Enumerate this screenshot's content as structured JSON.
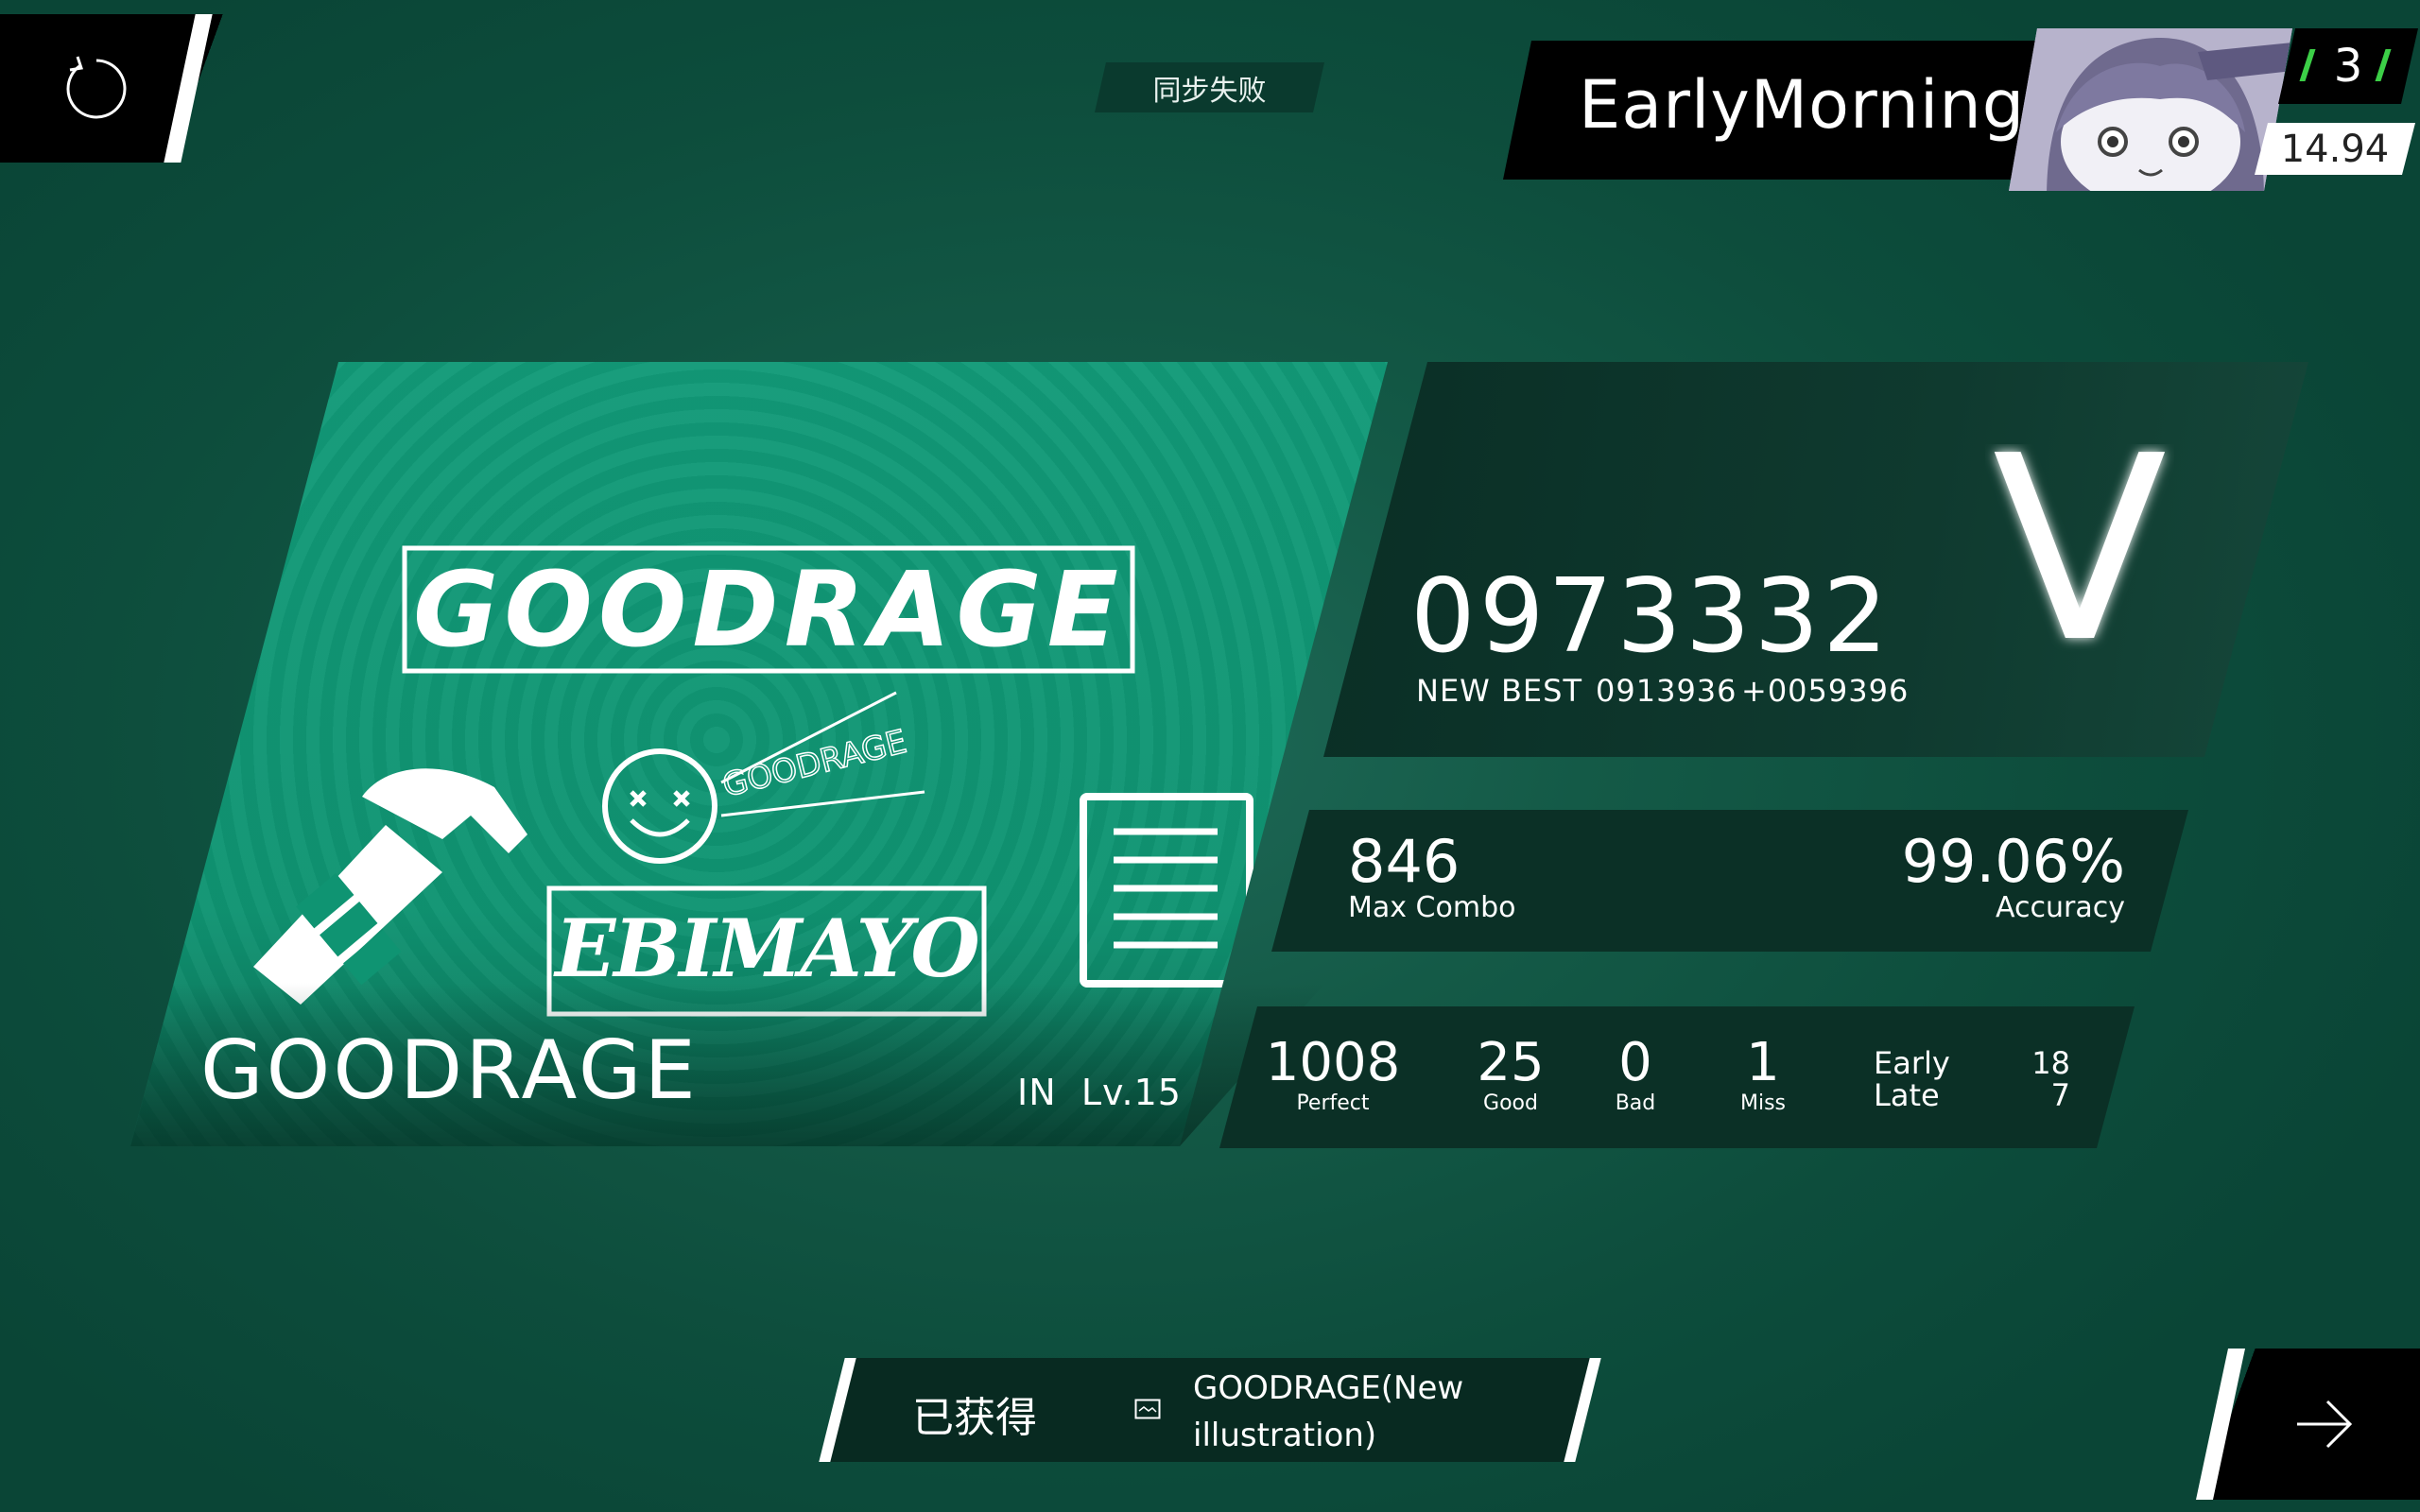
{
  "sync_status": "同步失败",
  "player": {
    "name": "EarlyMorning",
    "rank": "3",
    "rating": "14.94"
  },
  "song": {
    "title": "GOODRAGE",
    "difficulty": "IN",
    "level": "Lv.15",
    "artwork_texts": [
      "GOODRAGE",
      "GOODRAGE",
      "EBIMAYO"
    ]
  },
  "result": {
    "score": "0973332",
    "new_best_label": "NEW BEST",
    "previous_best": "0913936",
    "delta": "+0059396",
    "grade": "V",
    "max_combo": "846",
    "max_combo_label": "Max Combo",
    "accuracy": "99.06%",
    "accuracy_label": "Accuracy"
  },
  "judgements": [
    {
      "label": "Perfect",
      "value": "1008"
    },
    {
      "label": "Good",
      "value": "25"
    },
    {
      "label": "Bad",
      "value": "0"
    },
    {
      "label": "Miss",
      "value": "1"
    }
  ],
  "timing": {
    "early_label": "Early",
    "early": "18",
    "late_label": "Late",
    "late": "7"
  },
  "obtained": {
    "label": "已获得",
    "item": "GOODRAGE(New illustration)",
    "icon": "image-icon"
  },
  "icons": {
    "retry": "retry-icon",
    "next": "arrow-right-icon"
  },
  "colors": {
    "background": "#145a47",
    "accent": "#3ccf47",
    "art_green": "#129a78"
  }
}
